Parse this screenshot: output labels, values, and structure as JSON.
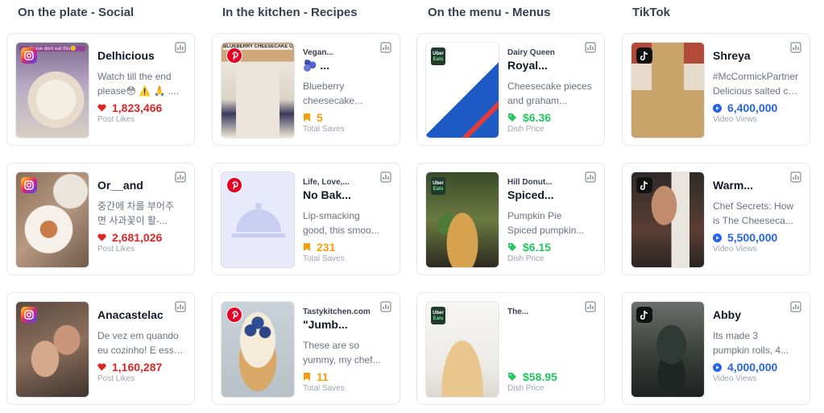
{
  "columns": [
    {
      "title": "On the plate - Social"
    },
    {
      "title": "In the kitchen - Recipes"
    },
    {
      "title": "On the menu - Menus"
    },
    {
      "title": "TikTok"
    }
  ],
  "colors": {
    "likes": "#dc2626",
    "saves": "#f59e0b",
    "price": "#22c55e",
    "views": "#2563eb"
  },
  "social": [
    {
      "name": "Delhicious",
      "desc1": "Watch till the end",
      "desc2": "please😳 ⚠️ 🙏 ....",
      "value": "1,823,466",
      "label": "Post Likes",
      "thumb_caption": "please dont eat this🙂"
    },
    {
      "name": "Or__and",
      "desc1": "중간에 차를 부어주",
      "desc2": "면 사과꽃이 활-...",
      "value": "2,681,026",
      "label": "Post Likes"
    },
    {
      "name": "Anacastelac",
      "desc1": "De vez em quando",
      "desc2": "eu cozinho! E esse ...",
      "value": "1,160,287",
      "label": "Post Likes"
    }
  ],
  "recipes": [
    {
      "source": "Vegan...",
      "name": "🫐 ...",
      "desc1": "Blueberry",
      "desc2": "cheesecake...",
      "value": "5",
      "label": "Total Saves",
      "thumb_caption": "BLUEBERRY CHEESECAKE OVERNIGHT OATS 🫐"
    },
    {
      "source": "Life, Love,...",
      "name": "No Bak...",
      "desc1": "Lip-smacking",
      "desc2": "good, this smoo...",
      "value": "231",
      "label": "Total Saves"
    },
    {
      "source": "Tastykitchen.com",
      "name": "\"Jumb...",
      "desc1": "These are so",
      "desc2": "yummy, my chef...",
      "value": "11",
      "label": "Total Saves"
    }
  ],
  "menus": [
    {
      "source": "Dairy Queen",
      "name": "Royal...",
      "desc1": "Cheesecake pieces",
      "desc2": "and graham...",
      "value": "$6.36",
      "label": "Dish Price"
    },
    {
      "source": "Hill Donut...",
      "name": "Spiced...",
      "desc1": "Pumpkin Pie",
      "desc2": "Spiced pumpkin...",
      "value": "$6.15",
      "label": "Dish Price"
    },
    {
      "source": "The...",
      "name": "",
      "desc1": "",
      "desc2": "",
      "value": "$58.95",
      "label": "Dish Price"
    }
  ],
  "tiktok": [
    {
      "name": "Shreya",
      "desc1": "#McCormickPartner",
      "desc2": "Delicious salted caram...",
      "value": "6,400,000",
      "label": "Video Views"
    },
    {
      "name": "Warm...",
      "desc1": "Chef Secrets: How",
      "desc2": "is The Cheeseca...",
      "value": "5,500,000",
      "label": "Video Views"
    },
    {
      "name": "Abby",
      "desc1": "Its made 3",
      "desc2": "pumpkin rolls, 4...",
      "value": "4,000,000",
      "label": "Video Views"
    }
  ],
  "icons": {
    "social_platform": "instagram-icon",
    "recipe_platform": "pinterest-icon",
    "menu_platform": "uber-eats-icon",
    "tiktok_platform": "tiktok-icon",
    "stat_social": "heart-icon",
    "stat_recipe": "bookmark-icon",
    "stat_menu": "price-tag-icon",
    "stat_tiktok": "play-icon",
    "action": "analytics-icon"
  },
  "uber_badge": {
    "line1": "Uber",
    "line2": "Eats"
  }
}
